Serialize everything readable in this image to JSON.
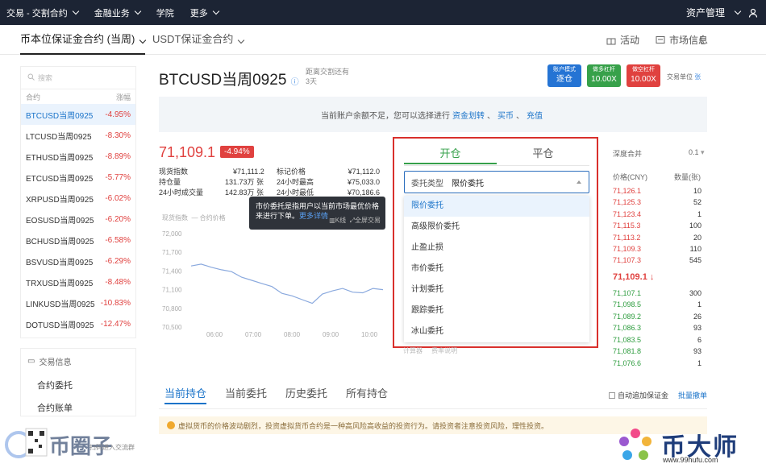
{
  "topnav": {
    "items": [
      "交易 - 交割合约",
      "金融业务",
      "学院",
      "更多"
    ],
    "right": "资产管理"
  },
  "subnav": {
    "tab_active": "币本位保证金合约 (当周)",
    "tab_other": "USDT保证金合约",
    "activity": "活动",
    "market_info": "市场信息"
  },
  "sidebar": {
    "search_placeholder": "搜索",
    "col_contract": "合约",
    "col_change": "涨幅",
    "items": [
      {
        "name": "BTCUSD当周0925",
        "change": "-4.95%"
      },
      {
        "name": "LTCUSD当周0925",
        "change": "-8.30%"
      },
      {
        "name": "ETHUSD当周0925",
        "change": "-8.89%"
      },
      {
        "name": "ETCUSD当周0925",
        "change": "-5.77%"
      },
      {
        "name": "XRPUSD当周0925",
        "change": "-6.02%"
      },
      {
        "name": "EOSUSD当周0925",
        "change": "-6.20%"
      },
      {
        "name": "BCHUSD当周0925",
        "change": "-6.58%"
      },
      {
        "name": "BSVUSD当周0925",
        "change": "-6.29%"
      },
      {
        "name": "TRXUSD当周0925",
        "change": "-8.48%"
      },
      {
        "name": "LINKUSD当周0925",
        "change": "-10.83%"
      },
      {
        "name": "DOTUSD当周0925",
        "change": "-12.47%"
      }
    ],
    "info_title": "交易信息",
    "links": [
      "合约委托",
      "合约账单"
    ]
  },
  "header": {
    "title": "BTCUSD当周0925",
    "expiry_label": "距离交割还有",
    "expiry_value": "3天",
    "buttons": [
      {
        "top": "账户模式",
        "bottom": "逐仓"
      },
      {
        "top": "做多杠杆",
        "bottom": "10.00X"
      },
      {
        "top": "做空杠杆",
        "bottom": "10.00X"
      }
    ],
    "unit_label": "交易单位",
    "unit_value": "张"
  },
  "notice": {
    "text": "当前账户余额不足，您可以选择进行",
    "link1": "资金划转",
    "link2": "买币",
    "link3": "充值"
  },
  "ticker": {
    "price": "71,109.1",
    "change": "-4.94%",
    "stats": [
      {
        "label": "现货指数",
        "value": "¥71,111.2"
      },
      {
        "label": "标记价格",
        "value": "¥71,112.0"
      },
      {
        "label": "持仓量",
        "value": "131.73万 张"
      },
      {
        "label": "24小时最高",
        "value": "¥75,033.0"
      },
      {
        "label": "24小时成交量",
        "value": "142.83万 张"
      },
      {
        "label": "24小时最低",
        "value": "¥70,186.6"
      }
    ]
  },
  "tooltip": {
    "text": "市价委托是指用户以当前市场最优价格来进行下单。",
    "link": "更多详情",
    "opt1": "K线",
    "opt2": "全屏交易"
  },
  "chart_data": {
    "type": "line",
    "series": [
      {
        "name": "合约价格",
        "values": [
          71480,
          71510,
          71460,
          71420,
          71390,
          71300,
          71250,
          71200,
          71150,
          71040,
          71000,
          70940,
          70880,
          71030,
          71080,
          71120,
          71060,
          71050,
          71120,
          71100
        ]
      }
    ],
    "legend": [
      "现货指数",
      "合约价格"
    ],
    "y_ticks": [
      "72,000",
      "71,700",
      "71,400",
      "71,100",
      "70,800",
      "70,500"
    ],
    "x_ticks": [
      "06:00",
      "07:00",
      "08:00",
      "09:00",
      "10:00"
    ],
    "ylim": [
      70500,
      72000
    ]
  },
  "order_panel": {
    "tab_open": "开仓",
    "tab_close": "平仓",
    "type_label": "委托类型",
    "type_value": "限价委托",
    "options": [
      "限价委托",
      "高级限价委托",
      "止盈止损",
      "市价委托",
      "计划委托",
      "跟踪委托",
      "冰山委托"
    ],
    "below": [
      "计算器",
      "费率说明"
    ]
  },
  "orderbook": {
    "depth_label": "深度合并",
    "depth_value": "0.1",
    "col_price": "价格(CNY)",
    "col_qty": "数量(张)",
    "asks": [
      {
        "p": "71,126.1",
        "q": "10"
      },
      {
        "p": "71,125.3",
        "q": "52"
      },
      {
        "p": "71,123.4",
        "q": "1"
      },
      {
        "p": "71,115.3",
        "q": "100"
      },
      {
        "p": "71,113.2",
        "q": "20"
      },
      {
        "p": "71,109.3",
        "q": "110"
      },
      {
        "p": "71,107.3",
        "q": "545"
      }
    ],
    "last": "71,109.1",
    "bids": [
      {
        "p": "71,107.1",
        "q": "300"
      },
      {
        "p": "71,098.5",
        "q": "1"
      },
      {
        "p": "71,089.2",
        "q": "26"
      },
      {
        "p": "71,086.3",
        "q": "93"
      },
      {
        "p": "71,083.5",
        "q": "6"
      },
      {
        "p": "71,081.8",
        "q": "93"
      },
      {
        "p": "71,076.6",
        "q": "1"
      }
    ]
  },
  "bottom": {
    "tabs": [
      "当前持仓",
      "当前委托",
      "历史委托",
      "所有持仓"
    ],
    "auto_margin": "自动追加保证金",
    "bulk_cancel": "批量撤单",
    "warning": "虚拟货币的价格波动剧烈，投资虚拟货币合约是一种高风险高收益的投资行为。请投资者注意投资风险，理性投资。"
  },
  "watermark": {
    "left": "币圈子",
    "left_sub": "扫码进入交流群",
    "right": "币大师",
    "right_url": "www.99hufu.com"
  }
}
